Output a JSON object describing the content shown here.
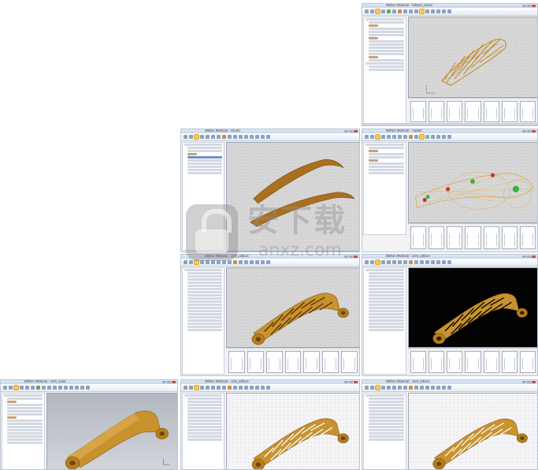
{
  "gallery": {
    "screens": [
      {
        "id": "lattice-cloud",
        "caption": "Within Medical - lattice_cloud",
        "view": "grid",
        "has_strip": true
      },
      {
        "id": "curved-struts",
        "caption": "Within Medical - struts",
        "view": "grid",
        "has_strip": false
      },
      {
        "id": "node-handles",
        "caption": "Within Medical - nodes",
        "view": "grid",
        "has_strip": true
      },
      {
        "id": "lattice-arm-grid",
        "caption": "Within Medical - arm_lattice",
        "view": "grid",
        "has_strip": true
      },
      {
        "id": "lattice-arm-dark",
        "caption": "Within Medical - arm_lattice",
        "view": "dark",
        "has_strip": true
      },
      {
        "id": "solid-arm",
        "caption": "Within Medical - arm_solid",
        "view": "gradient",
        "has_strip": false
      },
      {
        "id": "lattice-arm-plain-a",
        "caption": "Within Medical - arm_lattice",
        "view": "plain",
        "has_strip": false
      },
      {
        "id": "lattice-arm-plain-b",
        "caption": "Within Medical - arm_lattice",
        "view": "plain",
        "has_strip": false
      }
    ]
  },
  "watermark": {
    "logo_text": "安下载",
    "domain": "anxz.com"
  },
  "icons": {
    "ribbon": "toolbar-icon",
    "watermark": "shield-lock-icon"
  },
  "colors": {
    "model_gold": "#c8922e",
    "model_gold_dark": "#8a5a12",
    "node_red": "#c8322a",
    "node_green": "#36b23a",
    "selection_blue": "#6f90c8",
    "ribbon_highlight": "#f6c957"
  }
}
